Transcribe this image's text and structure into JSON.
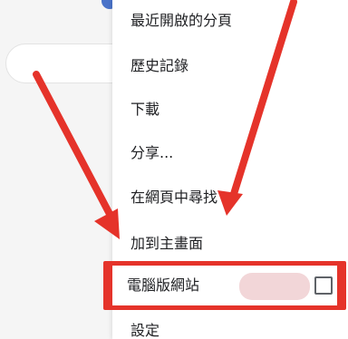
{
  "menu": {
    "items": [
      {
        "label": "最近開啟的分頁"
      },
      {
        "label": "歷史記錄"
      },
      {
        "label": "下載"
      },
      {
        "label": "分享..."
      },
      {
        "label": "在網頁中尋找"
      },
      {
        "label": "加到主畫面"
      },
      {
        "label": "電腦版網站",
        "checkbox_checked": false
      },
      {
        "label": "設定"
      }
    ]
  },
  "colors": {
    "arrow": "#e5332a",
    "highlight_border": "#e5332a",
    "menu_bg": "#ffffff",
    "text": "#202124"
  }
}
